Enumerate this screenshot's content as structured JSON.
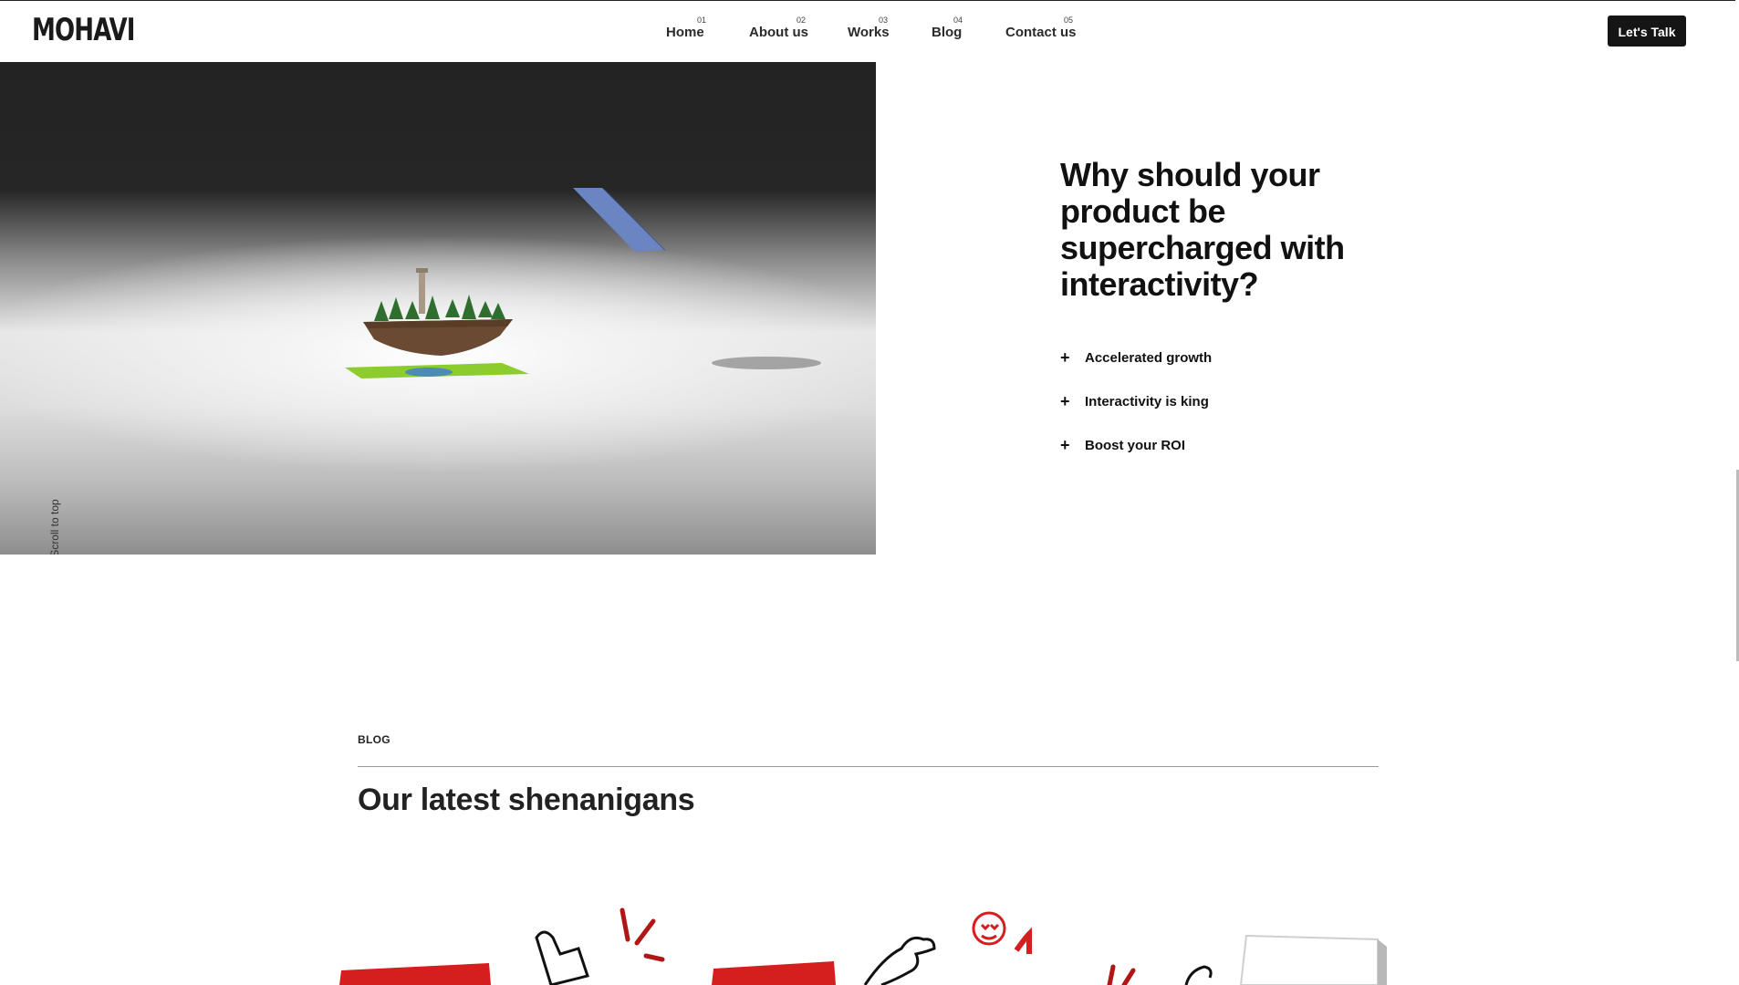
{
  "brand": {
    "logo_text": "MOHAVI"
  },
  "nav": {
    "items": [
      {
        "num": "01",
        "label": "Home"
      },
      {
        "num": "02",
        "label": "About us"
      },
      {
        "num": "03",
        "label": "Works"
      },
      {
        "num": "04",
        "label": "Blog"
      },
      {
        "num": "05",
        "label": "Contact us"
      }
    ],
    "cta_label": "Let's Talk"
  },
  "hero": {
    "scroll_to_top_label": "Scroll to top"
  },
  "why": {
    "title": "Why should your product be supercharged with interactivity?",
    "benefits": [
      {
        "icon": "plus-icon",
        "label": "Accelerated growth"
      },
      {
        "icon": "plus-icon",
        "label": "Interactivity is king"
      },
      {
        "icon": "plus-icon",
        "label": "Boost your ROI"
      }
    ]
  },
  "blog": {
    "kicker": "BLOG",
    "title": "Our latest shenanigans"
  },
  "colors": {
    "accent_red": "#d51f1f",
    "dark": "#151515",
    "text": "#1a1a1a",
    "phone_blue": "#6b84c2",
    "grass_green": "#8ccc2d"
  }
}
